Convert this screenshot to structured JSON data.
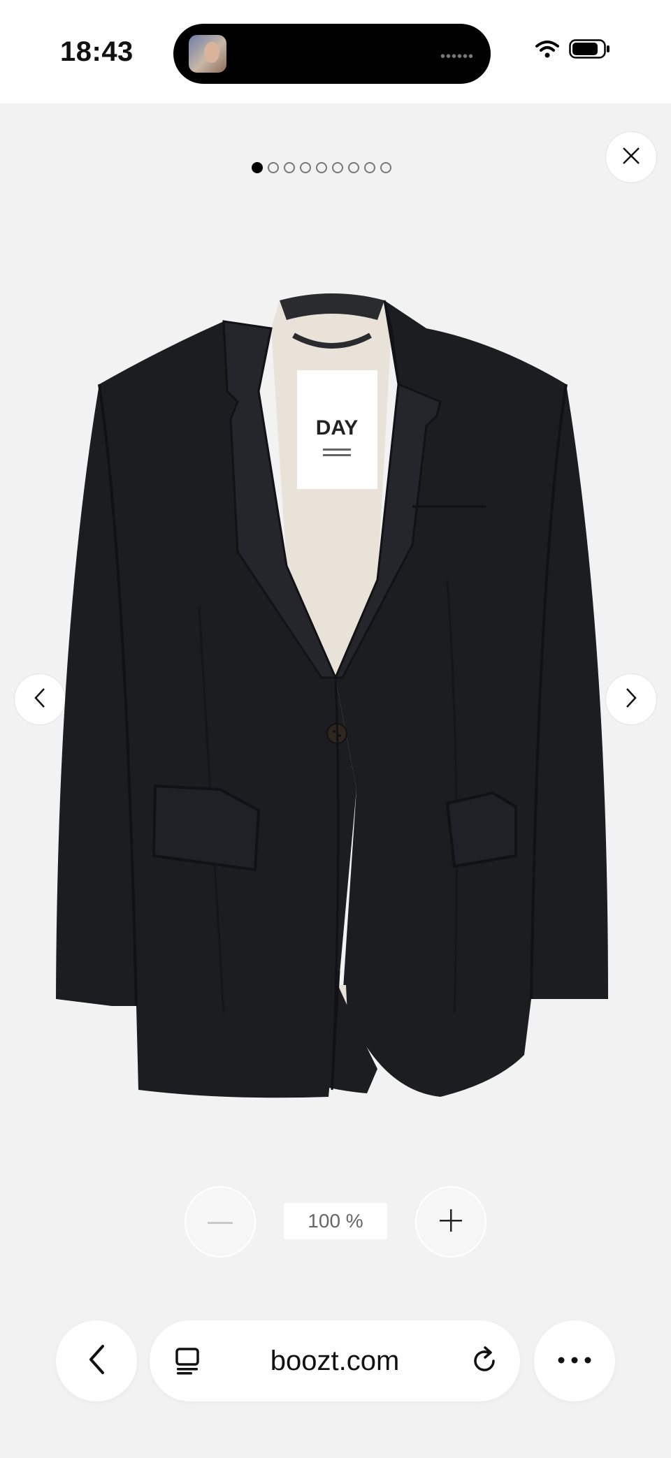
{
  "status_bar": {
    "time": "18:43",
    "island_dots": "••••••",
    "icons": [
      "wifi-icon",
      "battery-icon"
    ]
  },
  "gallery": {
    "image_count": 9,
    "active_index": 0,
    "close_icon": "close-icon",
    "prev_icon": "chevron-left-icon",
    "next_icon": "chevron-right-icon",
    "product_label_text": "DAY"
  },
  "zoom": {
    "level_text": "100 %",
    "minus_icon": "minus-icon",
    "plus_icon": "plus-icon"
  },
  "browser": {
    "url": "boozt.com",
    "back_icon": "chevron-left-icon",
    "tabs_icon": "tabs-icon",
    "reload_icon": "reload-icon",
    "more_icon": "more-icon"
  },
  "colors": {
    "background": "#f2f2f2",
    "jacket": "#1c1d21",
    "lining": "#e8e2d8"
  }
}
